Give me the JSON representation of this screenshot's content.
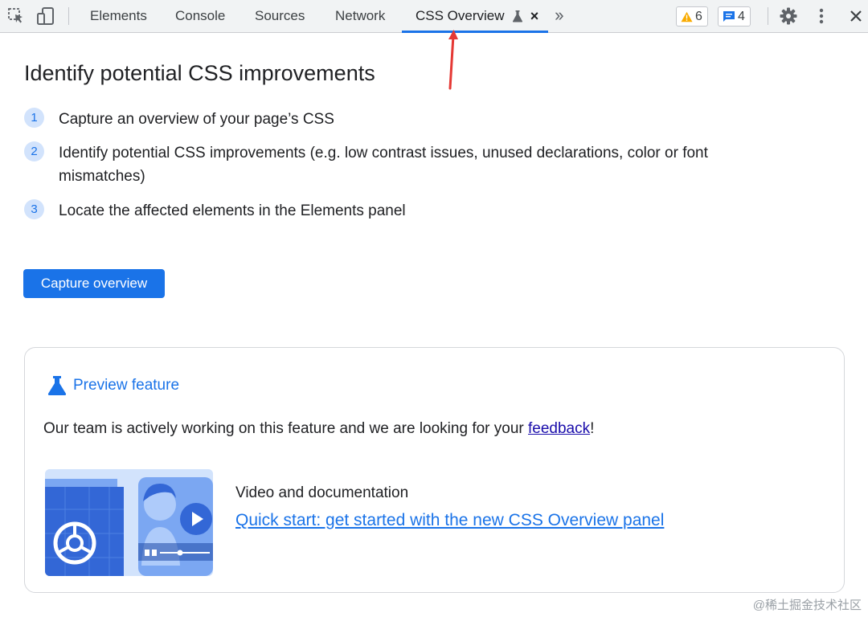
{
  "toolbar": {
    "tabs": [
      {
        "label": "Elements"
      },
      {
        "label": "Console"
      },
      {
        "label": "Sources"
      },
      {
        "label": "Network"
      },
      {
        "label": "CSS Overview",
        "active": true
      }
    ],
    "warnings_count": "6",
    "messages_count": "4",
    "icons": [
      "inspect-element-icon",
      "device-toolbar-icon",
      "experiment-flask-icon",
      "close-tab-icon",
      "more-tabs-icon",
      "warning-icon",
      "message-icon",
      "gear-icon",
      "kebab-menu-icon",
      "close-icon"
    ]
  },
  "main": {
    "title": "Identify potential CSS improvements",
    "steps": [
      {
        "num": "1",
        "text": "Capture an overview of your page’s CSS"
      },
      {
        "num": "2",
        "text": "Identify potential CSS improvements (e.g. low contrast issues, unused declarations, color or font mismatches)"
      },
      {
        "num": "3",
        "text": "Locate the affected elements in the Elements panel"
      }
    ],
    "capture_button": "Capture overview"
  },
  "preview": {
    "label": "Preview feature",
    "feedback_text_before": "Our team is actively working on this feature and we are looking for your ",
    "feedback_link": "feedback",
    "feedback_text_after": "!",
    "video_heading": "Video and documentation",
    "video_link": "Quick start: get started with the new CSS Overview panel"
  },
  "colors": {
    "accent": "#1a73e8",
    "annotation_arrow": "#e53935",
    "warning": "#f9ab00"
  },
  "watermark": "@稀土掘金技术社区"
}
